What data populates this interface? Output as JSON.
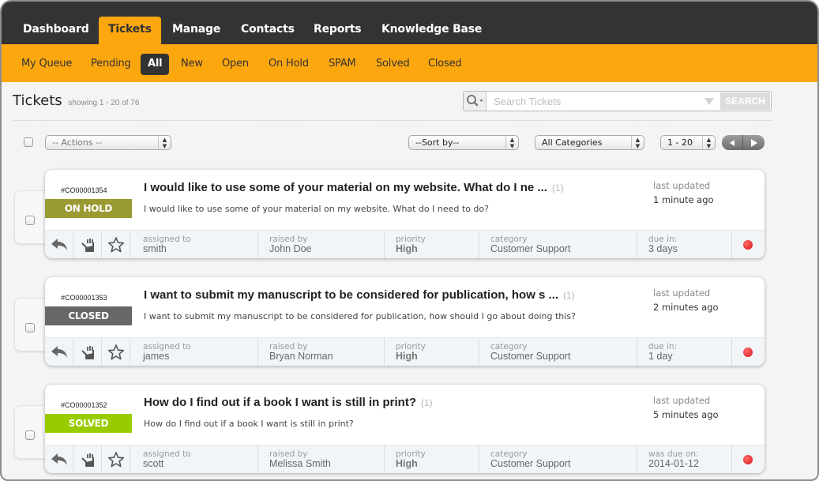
{
  "nav": {
    "tabs": [
      {
        "label": "Dashboard",
        "active": false
      },
      {
        "label": "Tickets",
        "active": true
      },
      {
        "label": "Manage",
        "active": false
      },
      {
        "label": "Contacts",
        "active": false
      },
      {
        "label": "Reports",
        "active": false
      },
      {
        "label": "Knowledge Base",
        "active": false
      }
    ],
    "subtabs": [
      {
        "label": "My Queue",
        "active": false
      },
      {
        "label": "Pending",
        "active": false
      },
      {
        "label": "All",
        "active": true
      },
      {
        "label": "New",
        "active": false
      },
      {
        "label": "Open",
        "active": false
      },
      {
        "label": "On Hold",
        "active": false
      },
      {
        "label": "SPAM",
        "active": false
      },
      {
        "label": "Solved",
        "active": false
      },
      {
        "label": "Closed",
        "active": false
      }
    ]
  },
  "header": {
    "title": "Tickets",
    "showing": "showing 1 - 20 of 76"
  },
  "search": {
    "placeholder": "Search Tickets",
    "value": "",
    "button_label": "SEARCH"
  },
  "toolbar": {
    "actions": "-- Actions --",
    "sort_by": "--Sort by--",
    "category": "All Categories",
    "range": "1 - 20",
    "prev_label": "previous page",
    "next_label": "next page"
  },
  "colors": {
    "nav_bg": "#333333",
    "accent": "#fca70e",
    "status_on_hold": "#9a9a33",
    "status_closed": "#676767",
    "status_solved": "#99cc00",
    "priority_dot": "#d81616"
  },
  "tickets": [
    {
      "id": "#CO00001354",
      "status": "ON HOLD",
      "status_color": "#9a9a33",
      "title": "I would like to use some of your material on my website. What do I ne ...",
      "count": "(1)",
      "excerpt": "I would like to use some of your material on my website. What do I need to do?",
      "updated_label": "last updated",
      "updated_value": "1 minute ago",
      "assigned_label": "assigned to",
      "assigned_to": "smith",
      "raised_label": "raised by",
      "raised_by": "John Doe",
      "priority_label": "priority",
      "priority": "High",
      "category_label": "category",
      "category": "Customer Support",
      "due_label": "due in:",
      "due": "3 days"
    },
    {
      "id": "#CO00001353",
      "status": "CLOSED",
      "status_color": "#676767",
      "title": "I want to submit my manuscript to be considered for publication, how s ...",
      "count": "(1)",
      "excerpt": "I want to submit my manuscript to be considered for publication, how should I go about doing this?",
      "updated_label": "last updated",
      "updated_value": "2 minutes ago",
      "assigned_label": "assigned to",
      "assigned_to": "james",
      "raised_label": "raised by",
      "raised_by": "Bryan Norman",
      "priority_label": "priority",
      "priority": "High",
      "category_label": "category",
      "category": "Customer Support",
      "due_label": "due in:",
      "due": "1 day"
    },
    {
      "id": "#CO00001352",
      "status": "SOLVED",
      "status_color": "#99cc00",
      "title": "How do I find out if a book I want is still in print?",
      "count": "(1)",
      "excerpt": "How do I find out if a book I want is still in print?",
      "updated_label": "last updated",
      "updated_value": "5 minutes ago",
      "assigned_label": "assigned to",
      "assigned_to": "scott",
      "raised_label": "raised by",
      "raised_by": "Melissa Smith",
      "priority_label": "priority",
      "priority": "High",
      "category_label": "category",
      "category": "Customer Support",
      "due_label": "was due on:",
      "due": "2014-01-12"
    }
  ]
}
